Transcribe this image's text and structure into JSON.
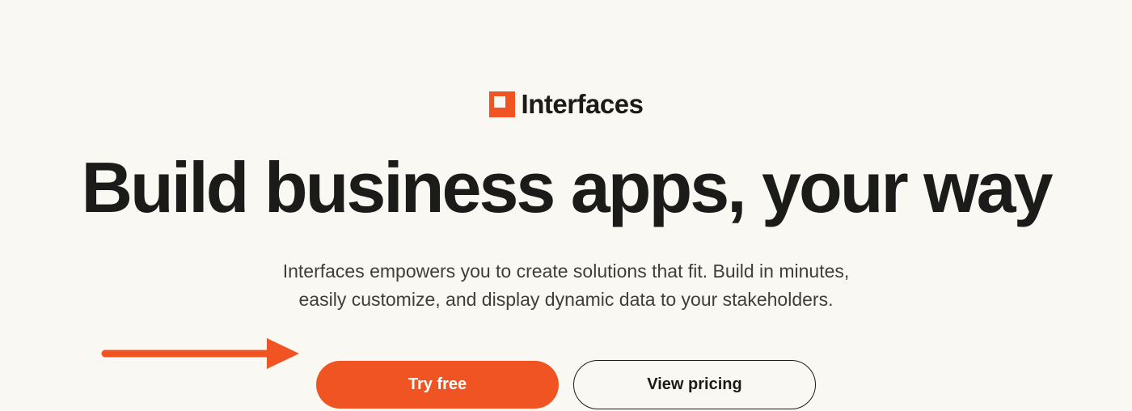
{
  "brand": {
    "name": "Interfaces"
  },
  "hero": {
    "headline": "Build business apps, your way",
    "subtext": "Interfaces empowers you to create solutions that fit. Build in minutes, easily customize, and display dynamic data to your stakeholders."
  },
  "cta": {
    "primary_label": "Try free",
    "secondary_label": "View pricing"
  },
  "colors": {
    "accent": "#f05423",
    "background": "#faf8f3",
    "text_primary": "#1b1b19",
    "text_secondary": "#403e3a"
  }
}
